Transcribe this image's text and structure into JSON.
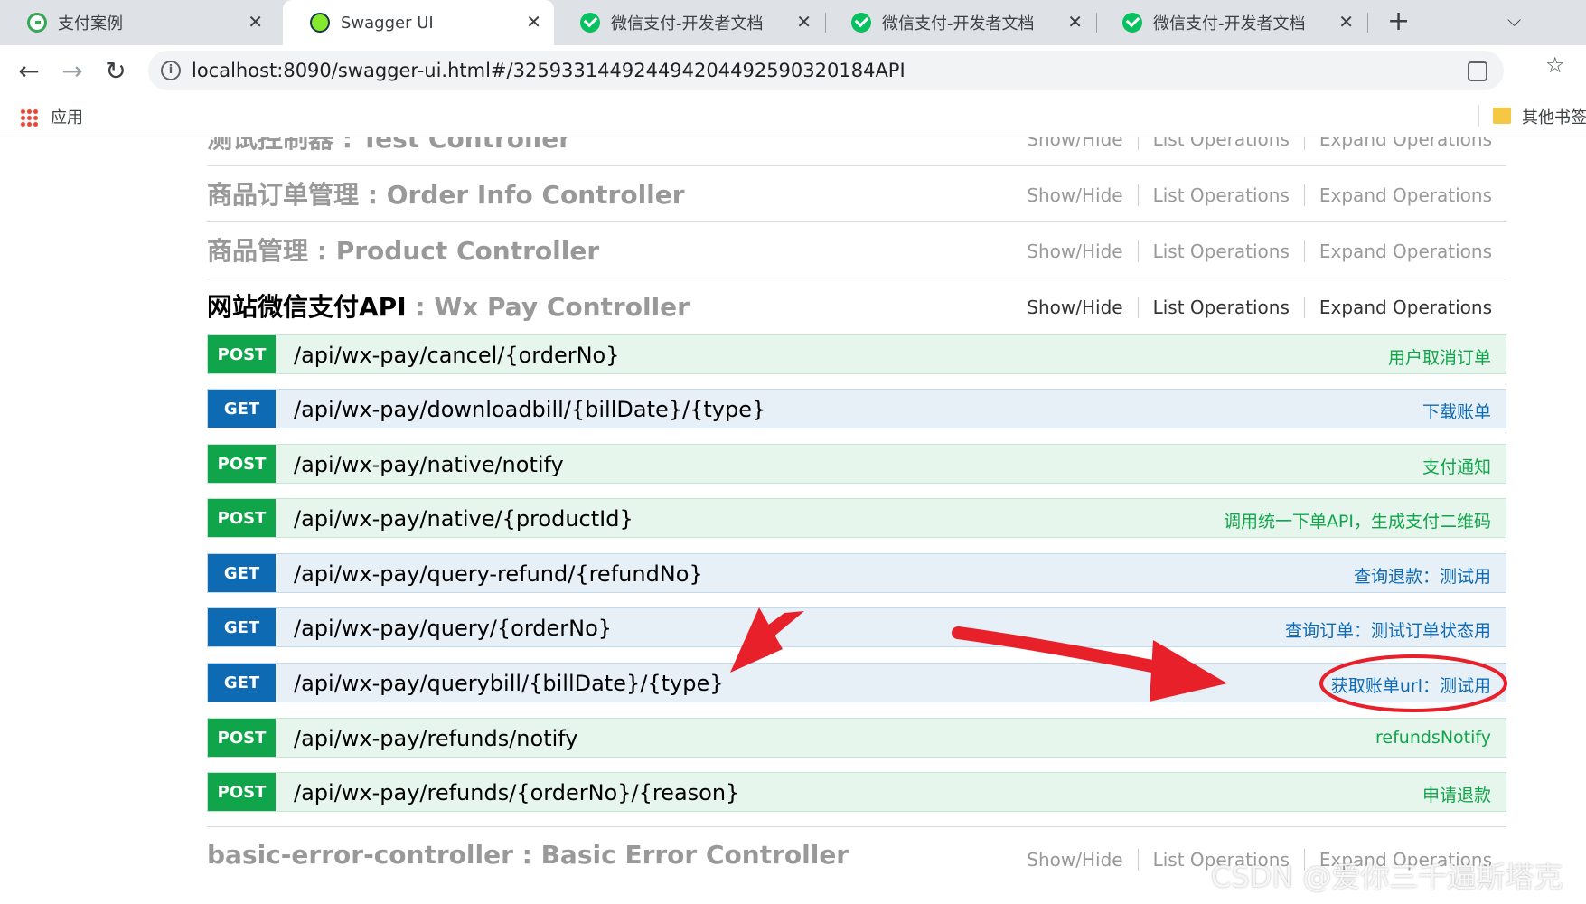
{
  "browser": {
    "tabs": [
      {
        "title": "支付案例",
        "icon": "g-logo-icon"
      },
      {
        "title": "Swagger UI",
        "icon": "swagger-icon"
      },
      {
        "title": "微信支付-开发者文档",
        "icon": "wechat-icon"
      },
      {
        "title": "微信支付-开发者文档",
        "icon": "wechat-icon"
      },
      {
        "title": "微信支付-开发者文档",
        "icon": "wechat-icon"
      }
    ],
    "close_glyph": "✕",
    "new_tab_glyph": "+",
    "url": "localhost:8090/swagger-ui.html#/32593314492449420449259032018​4API",
    "bookmarks": {
      "apps_label": "应用",
      "other_label": "其他书签"
    }
  },
  "swagger": {
    "ops_labels": {
      "show_hide": "Show/Hide",
      "list": "List Operations",
      "expand": "Expand Operations"
    },
    "resources": [
      {
        "name": "测试控制器",
        "controller": "Test Controller"
      },
      {
        "name": "商品订单管理",
        "controller": "Order Info Controller"
      },
      {
        "name": "商品管理",
        "controller": "Product Controller"
      },
      {
        "name": "网站微信支付API",
        "controller": "Wx Pay Controller"
      },
      {
        "name": "basic-error-controller",
        "controller": "Basic Error Controller"
      }
    ],
    "separator": " : ",
    "endpoints": [
      {
        "method": "POST",
        "path": "/api/wx-pay/cancel/{orderNo}",
        "summary": "用户取消订单"
      },
      {
        "method": "GET",
        "path": "/api/wx-pay/downloadbill/{billDate}/{type}",
        "summary": "下载账单"
      },
      {
        "method": "POST",
        "path": "/api/wx-pay/native/notify",
        "summary": "支付通知"
      },
      {
        "method": "POST",
        "path": "/api/wx-pay/native/{productId}",
        "summary": "调用统一下单API，生成支付二维码"
      },
      {
        "method": "GET",
        "path": "/api/wx-pay/query-refund/{refundNo}",
        "summary": "查询退款：测试用"
      },
      {
        "method": "GET",
        "path": "/api/wx-pay/query/{orderNo}",
        "summary": "查询订单：测试订单状态用"
      },
      {
        "method": "GET",
        "path": "/api/wx-pay/querybill/{billDate}/{type}",
        "summary": "获取账单url：测试用"
      },
      {
        "method": "POST",
        "path": "/api/wx-pay/refunds/notify",
        "summary": "refundsNotify"
      },
      {
        "method": "POST",
        "path": "/api/wx-pay/refunds/{orderNo}/{reason}",
        "summary": "申请退款"
      }
    ]
  },
  "watermark": "CSDN @爱你三千遍斯塔克",
  "colors": {
    "post": "#10a54a",
    "get": "#0f6ab4",
    "annotation": "#e8202a"
  }
}
